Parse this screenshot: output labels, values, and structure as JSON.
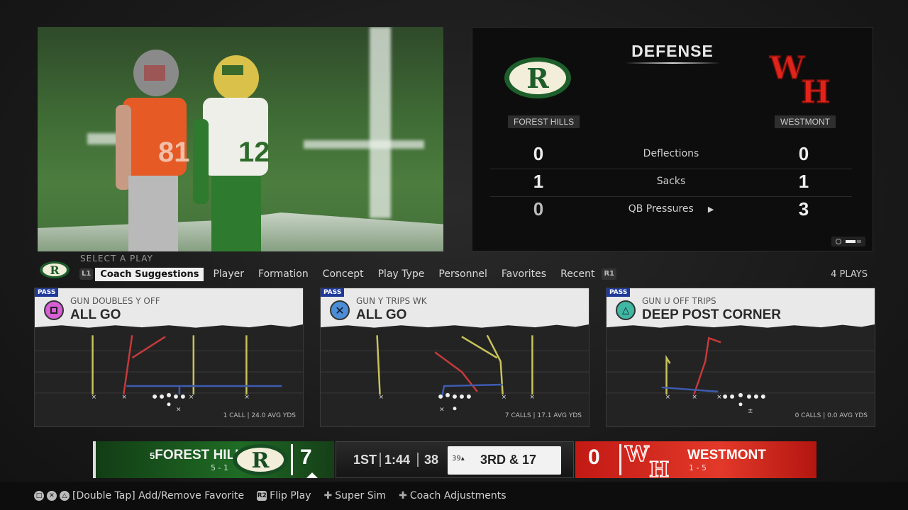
{
  "stats_panel": {
    "title": "DEFENSE",
    "home_team": "FOREST HILLS",
    "away_team": "WESTMONT",
    "rows": [
      {
        "label": "Deflections",
        "home": "0",
        "away": "0"
      },
      {
        "label": "Sacks",
        "home": "1",
        "away": "1"
      },
      {
        "label": "QB Pressures",
        "home": "0",
        "away": "3"
      }
    ]
  },
  "select_bar": {
    "heading": "SELECT A PLAY",
    "left_bumper": "L1",
    "right_bumper": "R1",
    "tabs": [
      "Coach Suggestions",
      "Player",
      "Formation",
      "Concept",
      "Play Type",
      "Personnel",
      "Favorites",
      "Recent"
    ],
    "plays_count": "4 PLAYS"
  },
  "plays": [
    {
      "tag": "PASS",
      "formation": "GUN DOUBLES Y OFF",
      "name": "ALL GO",
      "button": "square",
      "footer": "1 CALL | 24.0 AVG YDS"
    },
    {
      "tag": "PASS",
      "formation": "GUN Y TRIPS WK",
      "name": "ALL GO",
      "button": "cross",
      "footer": "7 CALLS | 17.1 AVG YDS"
    },
    {
      "tag": "PASS",
      "formation": "GUN U OFF TRIPS",
      "name": "DEEP POST CORNER",
      "button": "triangle",
      "footer": "0 CALLS | 0.0 AVG YDS"
    }
  ],
  "scorebug": {
    "home": {
      "rank": "5",
      "name": "FOREST HILLS",
      "record": "5 - 1",
      "score": "7",
      "color": "#1f6b24"
    },
    "quarter": "1ST",
    "clock": "1:44",
    "play_clock": "38",
    "ball_on": "39",
    "down_distance": "3RD & 17",
    "away": {
      "name": "WESTMONT",
      "record": "1 - 5",
      "score": "0",
      "color": "#e2392a"
    }
  },
  "help_bar": {
    "favorite": "[Double Tap] Add/Remove Favorite",
    "flip": "Flip Play",
    "super_sim": "Super Sim",
    "coach_adj": "Coach Adjustments"
  },
  "video": {
    "jersey_a": "81",
    "jersey_b": "12"
  }
}
